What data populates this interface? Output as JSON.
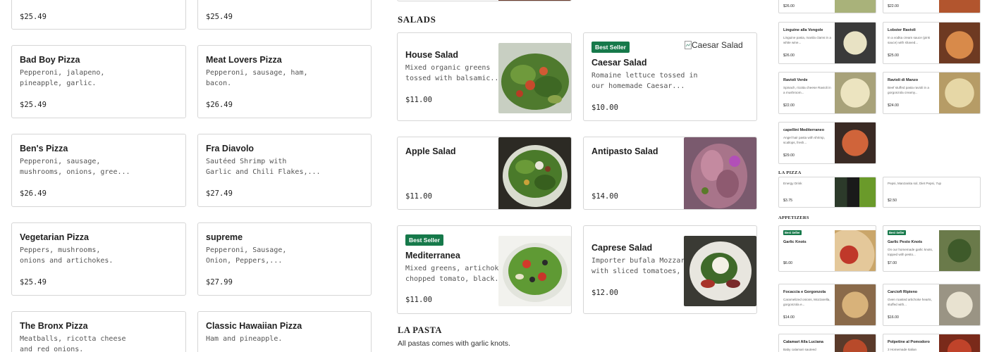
{
  "pizza": {
    "top_prices": [
      "$25.49",
      "$25.49"
    ],
    "items": [
      {
        "name": "Bad Boy Pizza",
        "desc": [
          "Pepperoni, jalapeno,",
          "pineapple, garlic."
        ],
        "price": "$25.49"
      },
      {
        "name": "Meat Lovers Pizza",
        "desc": [
          "Pepperoni, sausage, ham,",
          "bacon."
        ],
        "price": "$26.49"
      },
      {
        "name": "Ben's Pizza",
        "desc": [
          "Pepperoni, sausage,",
          "mushrooms, onions, gree..."
        ],
        "price": "$26.49"
      },
      {
        "name": "Fra Diavolo",
        "desc": [
          "Sautéed Shrimp with",
          "Garlic and Chili Flakes,..."
        ],
        "price": "$27.49"
      },
      {
        "name": "Vegetarian Pizza",
        "desc": [
          "Peppers, mushrooms,",
          "onions and artichokes."
        ],
        "price": "$25.49"
      },
      {
        "name": "supreme",
        "desc": [
          "Pepperoni, Sausage,",
          "Onion, Peppers,..."
        ],
        "price": "$27.99"
      },
      {
        "name": "The Bronx Pizza",
        "desc": [
          "Meatballs, ricotta cheese",
          "and red onions."
        ],
        "price": ""
      },
      {
        "name": "Classic Hawaiian Pizza",
        "desc": [
          "Ham and pineapple.",
          ""
        ],
        "price": ""
      }
    ]
  },
  "salads": {
    "title": "SALADS",
    "items": [
      {
        "name": "House Salad",
        "desc": [
          "Mixed organic greens",
          "tossed with balsamic..."
        ],
        "price": "$11.00",
        "badge": ""
      },
      {
        "name": "Caesar Salad",
        "desc": [
          "Romaine lettuce tossed in",
          "our homemade Caesar..."
        ],
        "price": "$10.00",
        "badge": "Best Seller",
        "alt": "Caesar Salad"
      },
      {
        "name": "Apple Salad",
        "desc": [
          "",
          ""
        ],
        "price": "$11.00",
        "badge": ""
      },
      {
        "name": "Antipasto Salad",
        "desc": [
          "",
          ""
        ],
        "price": "$14.00",
        "badge": ""
      },
      {
        "name": "Mediterranea",
        "desc": [
          "Mixed greens, artichokes,",
          "chopped tomato, black..."
        ],
        "price": "$11.00",
        "badge": "Best Seller"
      },
      {
        "name": "Caprese Salad",
        "desc": [
          "Importer bufala Mozzarella",
          "with sliced tomatoes, fre..."
        ],
        "price": "$12.00",
        "badge": ""
      }
    ]
  },
  "pasta": {
    "title": "LA PASTA",
    "subtitle": "All pastas comes with garlic knots."
  },
  "mini": {
    "top_prices": [
      "$26.00",
      "$22.00"
    ],
    "pasta_items": [
      {
        "name": "Linguine alla Vongole",
        "desc": "Linguine pasta, manila clams in a white wine...",
        "price": "$26.00"
      },
      {
        "name": "Lobster Ravioli",
        "desc": "In a vodka cream sauce (pink sauce) with shaved...",
        "price": "$25.00"
      },
      {
        "name": "Ravioli Verde",
        "desc": "Spinach, ricotta cheese Ravioli in a mushroom...",
        "price": "$22.00"
      },
      {
        "name": "Ravioli di Manzo",
        "desc": "Beef stuffed pasta ravioli in a gorgonzola creamy...",
        "price": "$24.00"
      },
      {
        "name": "capellini Mediterraneo",
        "desc": "Angel hair pasta with shrimp, scallops, fresh...",
        "price": "$29.00"
      }
    ],
    "la_pizza_title": "LA PIZZA",
    "drinks": [
      {
        "name": "",
        "desc": "Energy Drink",
        "price": "$3.75"
      },
      {
        "name": "",
        "desc": "Pepsi, Manzanita sol, Diet Pepsi, 7up",
        "price": "$2.50"
      }
    ],
    "appetizers_title": "APPETIZERS",
    "appetizers": [
      {
        "name": "Garlic Knots",
        "desc": "",
        "price": "$6.00",
        "badge": "Best Seller"
      },
      {
        "name": "Garlic Pesto Knots",
        "desc": "On our homemade garlic knots, topped with pesto...",
        "price": "$7.00",
        "badge": "Best Seller"
      },
      {
        "name": "Focaccia e Gorgonzola",
        "desc": "Caramelized onions, Mozzarella, gorgonzola e...",
        "price": "$14.00",
        "badge": ""
      },
      {
        "name": "Carciofi Ripieno",
        "desc": "Oven roasted artichoke hearts, stuffed with...",
        "price": "$16.00",
        "badge": ""
      },
      {
        "name": "Calamari Alla Luciana",
        "desc": "Baby calamari sauteed",
        "price": "",
        "badge": ""
      },
      {
        "name": "Polpetine al Pomodoro",
        "desc": "3 Homemade Italian",
        "price": "",
        "badge": ""
      }
    ]
  },
  "colors": {
    "badge": "#16794a",
    "border": "#d6d6d6"
  }
}
